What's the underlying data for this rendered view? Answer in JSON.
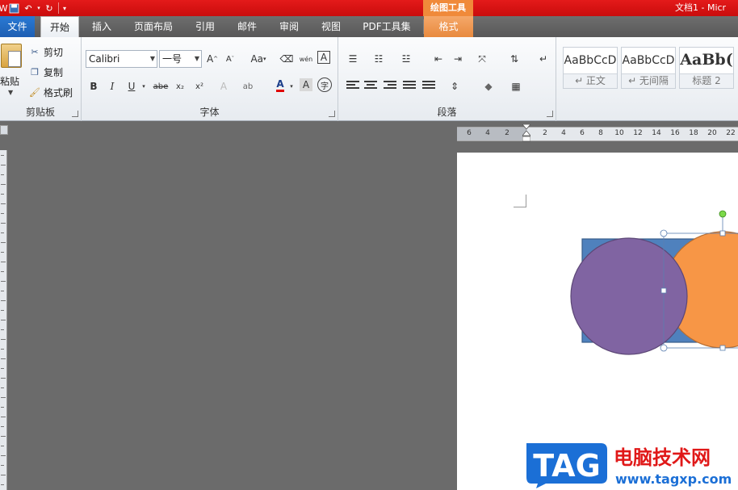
{
  "titlebar": {
    "drawing_tools": "绘图工具",
    "doc_title": "文档1 - Micr"
  },
  "tabs": {
    "file": "文件",
    "home": "开始",
    "insert": "插入",
    "layout": "页面布局",
    "references": "引用",
    "mailings": "邮件",
    "review": "审阅",
    "view": "视图",
    "pdf": "PDF工具集",
    "format": "格式"
  },
  "clipboard": {
    "paste": "粘贴",
    "cut": "剪切",
    "copy": "复制",
    "format_painter": "格式刷",
    "label": "剪贴板"
  },
  "font": {
    "name": "Calibri",
    "size": "一号",
    "grow": "A",
    "shrink": "A",
    "change_case": "Aa",
    "phonetic": "wén",
    "border_char": "A",
    "bold": "B",
    "italic": "I",
    "underline": "U",
    "strike": "abe",
    "subscript": "x₂",
    "superscript": "x²",
    "font_color": "A",
    "char_shading": "A",
    "enclose": "字",
    "label": "字体"
  },
  "paragraph": {
    "label": "段落"
  },
  "styles": {
    "items": [
      {
        "sample": "AaBbCcD",
        "name": "↵ 正文"
      },
      {
        "sample": "AaBbCcD",
        "name": "↵ 无间隔"
      },
      {
        "sample": "AaBb(",
        "name": "标题 2"
      }
    ]
  },
  "ruler": {
    "ticks": [
      "6",
      "4",
      "2",
      "2",
      "4",
      "6",
      "8",
      "10",
      "12",
      "14",
      "16",
      "18",
      "20",
      "22"
    ]
  },
  "logo": {
    "tag": "TAG",
    "title": "电脑技术网",
    "url": "www.tagxp.com"
  },
  "colors": {
    "title_red": "#d31414",
    "drawing_tools_orange": "#f08a3a",
    "rect_fill": "#4f81bd",
    "purple_circle": "#8064a2",
    "orange_circle": "#f79646"
  }
}
